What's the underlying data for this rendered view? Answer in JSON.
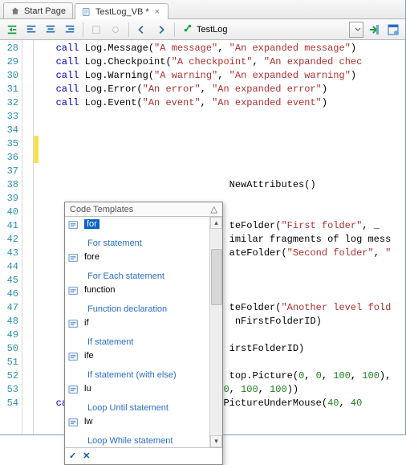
{
  "tabs": [
    {
      "label": "Start Page",
      "active": false
    },
    {
      "label": "TestLog_VB *",
      "active": true
    }
  ],
  "toolbar": {
    "function_name": "TestLog"
  },
  "code": {
    "first_line_no": 28,
    "line_count": 27,
    "lines": [
      {
        "n": 28,
        "mod": false,
        "segs": [
          {
            "cls": "kw",
            "t": "call "
          },
          {
            "cls": "obj",
            "t": "Log.Message("
          },
          {
            "cls": "str",
            "t": "\"A message\""
          },
          {
            "cls": "obj",
            "t": ", "
          },
          {
            "cls": "str",
            "t": "\"An expanded message\""
          },
          {
            "cls": "obj",
            "t": ")"
          }
        ]
      },
      {
        "n": 29,
        "mod": false,
        "segs": [
          {
            "cls": "kw",
            "t": "call "
          },
          {
            "cls": "obj",
            "t": "Log.Checkpoint("
          },
          {
            "cls": "str",
            "t": "\"A checkpoint\""
          },
          {
            "cls": "obj",
            "t": ", "
          },
          {
            "cls": "str",
            "t": "\"An expanded chec"
          }
        ]
      },
      {
        "n": 30,
        "mod": false,
        "segs": [
          {
            "cls": "kw",
            "t": "call "
          },
          {
            "cls": "obj",
            "t": "Log.Warning("
          },
          {
            "cls": "str",
            "t": "\"A warning\""
          },
          {
            "cls": "obj",
            "t": ", "
          },
          {
            "cls": "str",
            "t": "\"An expanded warning\""
          },
          {
            "cls": "obj",
            "t": ")"
          }
        ]
      },
      {
        "n": 31,
        "mod": false,
        "segs": [
          {
            "cls": "kw",
            "t": "call "
          },
          {
            "cls": "obj",
            "t": "Log.Error("
          },
          {
            "cls": "str",
            "t": "\"An error\""
          },
          {
            "cls": "obj",
            "t": ", "
          },
          {
            "cls": "str",
            "t": "\"An expanded error\""
          },
          {
            "cls": "obj",
            "t": ")"
          }
        ]
      },
      {
        "n": 32,
        "mod": false,
        "segs": [
          {
            "cls": "kw",
            "t": "call "
          },
          {
            "cls": "obj",
            "t": "Log.Event("
          },
          {
            "cls": "str",
            "t": "\"An event\""
          },
          {
            "cls": "obj",
            "t": ", "
          },
          {
            "cls": "str",
            "t": "\"An expanded event\""
          },
          {
            "cls": "obj",
            "t": ")"
          }
        ]
      },
      {
        "n": 33,
        "mod": false,
        "segs": []
      },
      {
        "n": 34,
        "mod": false,
        "segs": []
      },
      {
        "n": 35,
        "mod": true,
        "segs": []
      },
      {
        "n": 36,
        "mod": true,
        "segs": []
      },
      {
        "n": 37,
        "mod": false,
        "segs": []
      },
      {
        "n": 38,
        "mod": false,
        "segs": [
          {
            "cls": "obj",
            "t": "                              NewAttributes()"
          }
        ]
      },
      {
        "n": 39,
        "mod": false,
        "segs": []
      },
      {
        "n": 40,
        "mod": false,
        "segs": []
      },
      {
        "n": 41,
        "mod": false,
        "segs": [
          {
            "cls": "obj",
            "t": "                              teFolder("
          },
          {
            "cls": "str",
            "t": "\"First folder\""
          },
          {
            "cls": "obj",
            "t": ", _"
          }
        ]
      },
      {
        "n": 42,
        "mod": false,
        "segs": [
          {
            "cls": "obj",
            "t": "                              imilar fragments of log mess"
          }
        ]
      },
      {
        "n": 43,
        "mod": false,
        "segs": [
          {
            "cls": "obj",
            "t": "                              ateFolder("
          },
          {
            "cls": "str",
            "t": "\"Second folder\""
          },
          {
            "cls": "obj",
            "t": ", "
          },
          {
            "cls": "str",
            "t": "\""
          }
        ]
      },
      {
        "n": 44,
        "mod": false,
        "segs": []
      },
      {
        "n": 45,
        "mod": false,
        "segs": []
      },
      {
        "n": 46,
        "mod": false,
        "segs": []
      },
      {
        "n": 47,
        "mod": false,
        "segs": [
          {
            "cls": "obj",
            "t": "                              teFolder("
          },
          {
            "cls": "str",
            "t": "\"Another level fold"
          }
        ]
      },
      {
        "n": 48,
        "mod": false,
        "segs": [
          {
            "cls": "obj",
            "t": "                               nFirstFolderID)"
          }
        ]
      },
      {
        "n": 49,
        "mod": false,
        "segs": []
      },
      {
        "n": 50,
        "mod": false,
        "segs": [
          {
            "cls": "obj",
            "t": "                              irstFolderID)"
          }
        ]
      },
      {
        "n": 51,
        "mod": false,
        "segs": []
      },
      {
        "n": 52,
        "mod": false,
        "segs": [
          {
            "cls": "obj",
            "t": "                              top.Picture("
          },
          {
            "cls": "num",
            "t": "0"
          },
          {
            "cls": "obj",
            "t": ", "
          },
          {
            "cls": "num",
            "t": "0"
          },
          {
            "cls": "obj",
            "t": ", "
          },
          {
            "cls": "num",
            "t": "100"
          },
          {
            "cls": "obj",
            "t": ", "
          },
          {
            "cls": "num",
            "t": "100"
          },
          {
            "cls": "obj",
            "t": "),"
          }
        ]
      },
      {
        "n": 53,
        "mod": false,
        "segs": [
          {
            "cls": "obj",
            "t": "                           , "
          },
          {
            "cls": "num",
            "t": "0"
          },
          {
            "cls": "obj",
            "t": ", "
          },
          {
            "cls": "num",
            "t": "100"
          },
          {
            "cls": "obj",
            "t": ", "
          },
          {
            "cls": "num",
            "t": "100"
          },
          {
            "cls": "obj",
            "t": "))"
          }
        ]
      },
      {
        "n": 54,
        "mod": false,
        "segs": [
          {
            "cls": "kw",
            "t": "call "
          },
          {
            "cls": "obj",
            "t": "Log.Picture(Sys.Desktop.PictureUnderMouse("
          },
          {
            "cls": "num",
            "t": "40"
          },
          {
            "cls": "obj",
            "t": ", "
          },
          {
            "cls": "num",
            "t": "40"
          }
        ]
      }
    ]
  },
  "popup": {
    "title": "Code Templates",
    "items": [
      {
        "name": "for",
        "desc": "For statement",
        "sel": true
      },
      {
        "name": "fore",
        "desc": "For Each statement",
        "sel": false
      },
      {
        "name": "function",
        "desc": "Function declaration",
        "sel": false
      },
      {
        "name": "if",
        "desc": "If statement",
        "sel": false
      },
      {
        "name": "ife",
        "desc": "If statement (with else)",
        "sel": false
      },
      {
        "name": "lu",
        "desc": "Loop Until statement",
        "sel": false
      },
      {
        "name": "lw",
        "desc": "Loop While statement",
        "sel": false
      }
    ],
    "footer": {
      "accept": "✓",
      "cancel": "✕"
    }
  }
}
